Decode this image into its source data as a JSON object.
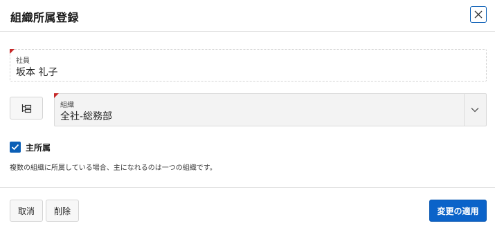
{
  "dialog": {
    "title": "組織所属登録",
    "close_icon": "close-icon"
  },
  "employee_field": {
    "label": "社員",
    "value": "坂本 礼子",
    "required": true
  },
  "org_field": {
    "tree_icon": "hierarchy-icon",
    "label": "組織",
    "value": "全社-総務部",
    "required": true,
    "dropdown_icon": "chevron-down-icon"
  },
  "primary_affiliation": {
    "checked": true,
    "label": "主所属",
    "help_text": "複数の組織に所属している場合、主になれるのは一つの組織です。"
  },
  "footer": {
    "cancel_label": "取消",
    "delete_label": "削除",
    "apply_label": "変更の適用"
  },
  "colors": {
    "accent": "#0b63c9",
    "required_marker": "#c62828"
  }
}
